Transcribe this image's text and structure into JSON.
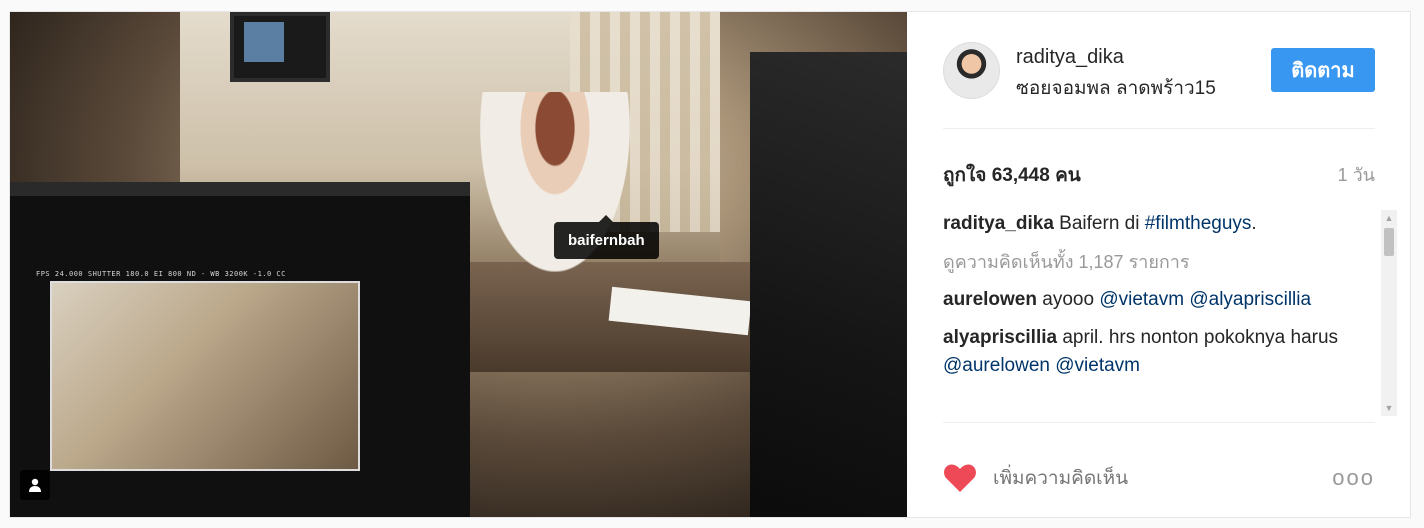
{
  "post": {
    "photo_tag": "baifernbah",
    "user_tag_icon": "user-icon"
  },
  "header": {
    "username": "raditya_dika",
    "location": "ซอยจอมพล ลาดพร้าว15",
    "follow_label": "ติดตาม"
  },
  "stats": {
    "likes": "ถูกใจ 63,448 คน",
    "time": "1 วัน"
  },
  "caption": {
    "author": "raditya_dika",
    "text": " Baifern di ",
    "hashtag": "#filmtheguys",
    "suffix": "."
  },
  "view_all_comments": "ดูความคิดเห็นทั้ง 1,187 รายการ",
  "comments": [
    {
      "author": "aurelowen",
      "text": " ayooo ",
      "mentions": [
        "@vietavm",
        "@alyapriscillia"
      ]
    },
    {
      "author": "alyapriscillia",
      "text": " april. hrs nonton pokoknya harus ",
      "mentions": [
        "@aurelowen",
        "@vietavm"
      ]
    }
  ],
  "footer": {
    "add_comment_placeholder": "เพิ่มความคิดเห็น",
    "more_label": "ooo"
  },
  "colors": {
    "accent": "#3897f0",
    "heart": "#ed4956",
    "link": "#003569"
  }
}
